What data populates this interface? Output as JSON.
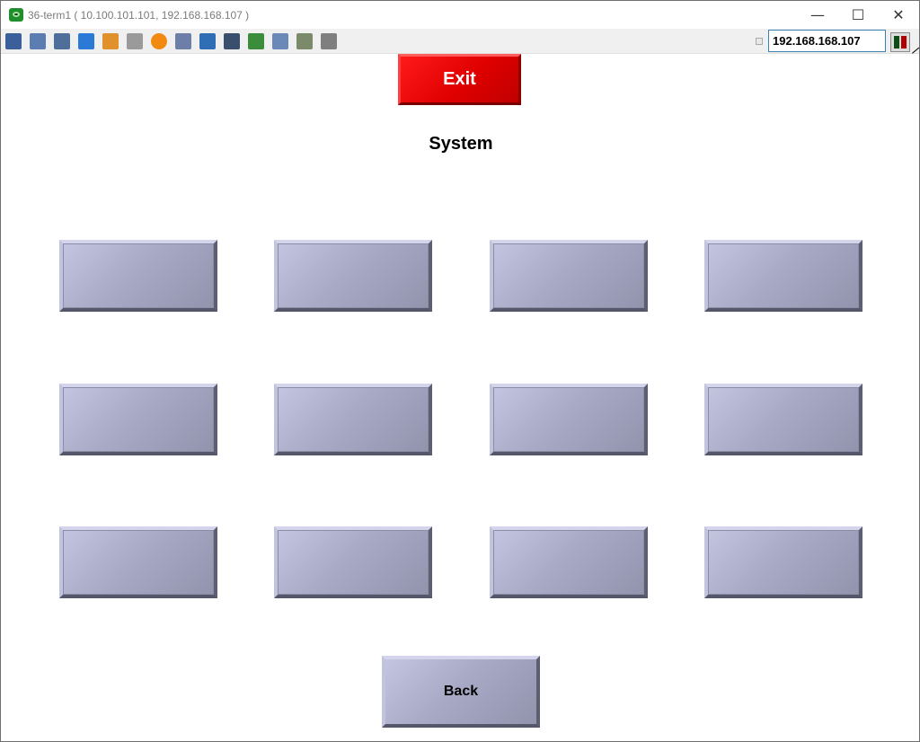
{
  "window": {
    "title": "36-term1 ( 10.100.101.101, 192.168.168.107 )",
    "minimize_glyph": "—",
    "maximize_glyph": "☐",
    "close_glyph": "✕"
  },
  "toolbar": {
    "icons": [
      {
        "name": "monitor-graph-icon",
        "color": "#3a5f9b"
      },
      {
        "name": "windows-stack-icon",
        "color": "#5b7db1"
      },
      {
        "name": "tools-icon",
        "color": "#4d6f99"
      },
      {
        "name": "refresh-icon",
        "color": "#2c7ad6"
      },
      {
        "name": "windows-logo-icon",
        "color": "#e0912b"
      },
      {
        "name": "keyboard-icon",
        "color": "#9a9a9a"
      },
      {
        "name": "alert-icon",
        "color": "#f28a12"
      },
      {
        "name": "disconnect-icon",
        "color": "#6b7fa8"
      },
      {
        "name": "fullscreen-icon",
        "color": "#2f6db5"
      },
      {
        "name": "display-icon",
        "color": "#3a4f6e"
      },
      {
        "name": "download-icon",
        "color": "#3b8c3b"
      },
      {
        "name": "notepad-icon",
        "color": "#6a88b8"
      },
      {
        "name": "screen-capture-icon",
        "color": "#7a8a6a"
      },
      {
        "name": "chat-icon",
        "color": "#7f7f7f"
      }
    ],
    "ip_address": "192.168.168.107",
    "status_colors": [
      "#0b4d12",
      "#b00000"
    ]
  },
  "main": {
    "exit_label": "Exit",
    "title": "System",
    "back_label": "Back",
    "grid_buttons": [
      "",
      "",
      "",
      "",
      "",
      "",
      "",
      "",
      "",
      "",
      "",
      ""
    ]
  }
}
